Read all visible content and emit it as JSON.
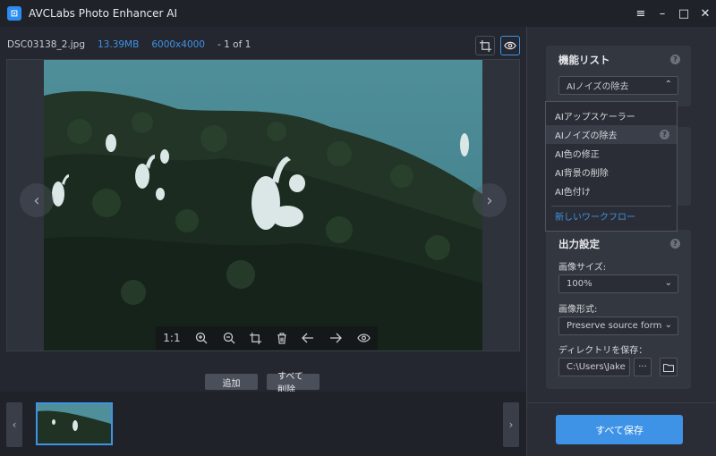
{
  "app": {
    "title": "AVCLabs Photo Enhancer AI",
    "logo_glyph": "⊡"
  },
  "window_controls": {
    "menu": "≡",
    "minimize": "–",
    "maximize": "□",
    "close": "✕"
  },
  "file_info": {
    "name": "DSC03138_2.jpg",
    "size": "13.39MB",
    "resolution": "6000x4000",
    "count": "- 1 of 1"
  },
  "viewer": {
    "prev": "‹",
    "next": "›"
  },
  "image_toolbar": {
    "ratio": "1:1"
  },
  "actions": {
    "add": "追加",
    "delete_all": "すべて削除"
  },
  "strip": {
    "prev": "‹",
    "next": "›"
  },
  "feature_list": {
    "title": "機能リスト",
    "selected": "AIノイズの除去",
    "help": "?",
    "options": [
      "AIアップスケーラー",
      "AIノイズの除去",
      "AI色の修正",
      "AI背景の削除",
      "AI色付け"
    ],
    "new_workflow": "新しいワークフロー"
  },
  "output": {
    "title": "出力設定",
    "help": "?",
    "size_label": "画像サイズ:",
    "size_value": "100%",
    "format_label": "画像形式:",
    "format_value": "Preserve source format",
    "dir_label": "ディレクトリを保存：",
    "dir_value": "C:\\Users\\Jake",
    "more": "···"
  },
  "save_all": "すべて保存",
  "colors": {
    "accent": "#3f93e6",
    "panel": "#2a2d35",
    "background": "#24272f"
  }
}
